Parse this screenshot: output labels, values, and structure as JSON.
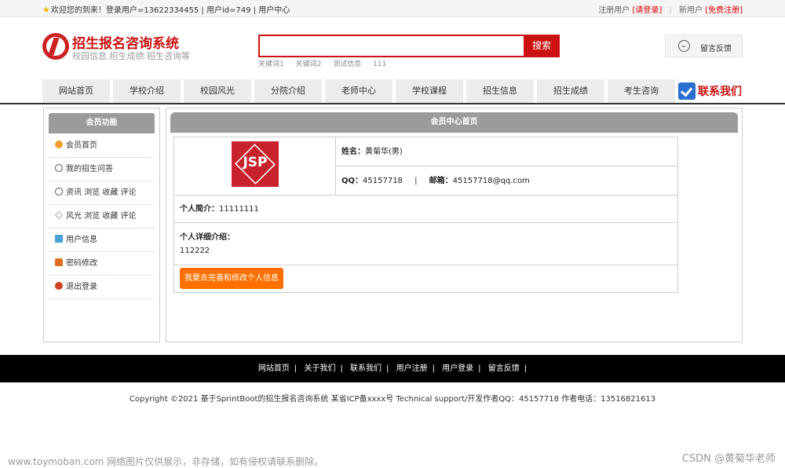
{
  "topbar": {
    "welcome": "欢迎您的到来！登录用户=13622334455 | 用户id=749 | 用户中心",
    "register_prefix": "注册用户",
    "login_link": "[请登录]",
    "new_user_prefix": "新用户",
    "free_register_link": "[免费注册]"
  },
  "header": {
    "site_title": "招生报名咨询系统",
    "site_subtitle": "校园信息.招生成绩.招生咨询等",
    "search_placeholder": "",
    "search_button": "搜索",
    "hot_words": [
      "关键词1",
      "关键词2",
      "测试信息",
      "111"
    ],
    "feedback": "留言反馈"
  },
  "nav": {
    "items": [
      "网站首页",
      "学校介绍",
      "校园风光",
      "分院介绍",
      "老师中心",
      "学校课程",
      "招生信息",
      "招生成绩",
      "考生咨询"
    ],
    "contact": "联系我们"
  },
  "sidebar": {
    "title": "会员功能",
    "items": [
      {
        "label": "会员首页",
        "icon": "home-icon",
        "color": "#f0a030"
      },
      {
        "label": "我的招生问答",
        "icon": "clock-icon",
        "color": "#555555"
      },
      {
        "label": "资讯 浏览 收藏 评论",
        "icon": "clock-icon",
        "color": "#555555"
      },
      {
        "label": "风光 浏览 收藏 评论",
        "icon": "star-icon",
        "color": "#888888"
      },
      {
        "label": "用户信息",
        "icon": "document-icon",
        "color": "#4aa0d8"
      },
      {
        "label": "密码修改",
        "icon": "lock-icon",
        "color": "#e07020"
      },
      {
        "label": "退出登录",
        "icon": "power-icon",
        "color": "#d04020"
      }
    ]
  },
  "main": {
    "title": "会员中心首页",
    "photo_text": "JSP",
    "name_label": "姓名：",
    "name_value": "黄菊华(男)",
    "qq_label": "QQ：",
    "qq_value": "45157718",
    "divider": "|",
    "email_label": "邮箱：",
    "email_value": "45157718@qq.com",
    "intro_label": "个人简介：",
    "intro_value": "11111111",
    "detail_label": "个人详细介绍：",
    "detail_value": "112222",
    "edit_button": "我要去完善和修改个人信息"
  },
  "footer": {
    "links": [
      "网站首页",
      "关于我们",
      "联系我们",
      "用户注册",
      "用户登录",
      "留言反馈"
    ],
    "copyright": "Copyright ©2021 基于SprintBoot的招生报名咨询系统    某省ICP备xxxx号    Technical support/开发作者QQ：45157718    作者电话：13516821613"
  },
  "watermark": {
    "left": "www.toymoban.com 网络图片仅供展示，非存储，如有侵权请联系删除。",
    "right": "CSDN @黄菊华老师"
  },
  "colors": {
    "brand_red": "#cc1111",
    "panel_grey": "#9b9b9b",
    "button_orange": "#ff7000",
    "footer_bg": "#000000"
  }
}
